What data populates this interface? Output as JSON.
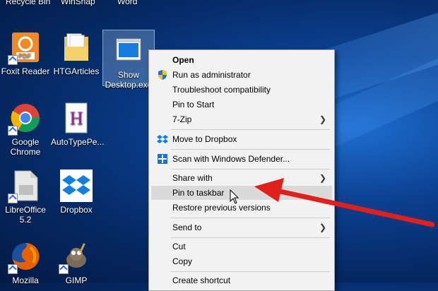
{
  "desktop": {
    "top_labels": [
      "Recycle Bin",
      "WinSnap",
      "Word"
    ],
    "icons": [
      {
        "label": "Foxit Reader",
        "icon": "foxit-icon"
      },
      {
        "label": "HTGArticles",
        "icon": "folder-icon"
      },
      {
        "label": "Show Desktop.exe",
        "icon": "show-desktop-icon"
      },
      {
        "label": "Google Chrome",
        "icon": "chrome-icon"
      },
      {
        "label": "AutoTypePe...",
        "icon": "autotype-icon"
      },
      {
        "label": "LibreOffice 5.2",
        "icon": "libreoffice-icon"
      },
      {
        "label": "Dropbox",
        "icon": "dropbox-icon"
      },
      {
        "label": "Mozilla",
        "icon": "firefox-icon"
      },
      {
        "label": "GIMP",
        "icon": "gimp-icon"
      }
    ]
  },
  "context_menu": {
    "items": [
      {
        "label": "Open",
        "bold": true
      },
      {
        "label": "Run as administrator",
        "icon": "shield-icon"
      },
      {
        "label": "Troubleshoot compatibility"
      },
      {
        "label": "Pin to Start"
      },
      {
        "label": "7-Zip",
        "submenu": true
      },
      {
        "label": "Move to Dropbox",
        "icon": "dropbox-icon"
      },
      {
        "label": "Scan with Windows Defender...",
        "icon": "defender-icon"
      },
      {
        "label": "Share with",
        "submenu": true
      },
      {
        "label": "Pin to taskbar",
        "highlighted": true
      },
      {
        "label": "Restore previous versions"
      },
      {
        "label": "Send to",
        "submenu": true
      },
      {
        "label": "Cut"
      },
      {
        "label": "Copy"
      },
      {
        "label": "Create shortcut"
      }
    ]
  },
  "colors": {
    "arrow": "#e0201c",
    "menu_bg": "#f2f2f2",
    "highlight": "#dadada"
  }
}
